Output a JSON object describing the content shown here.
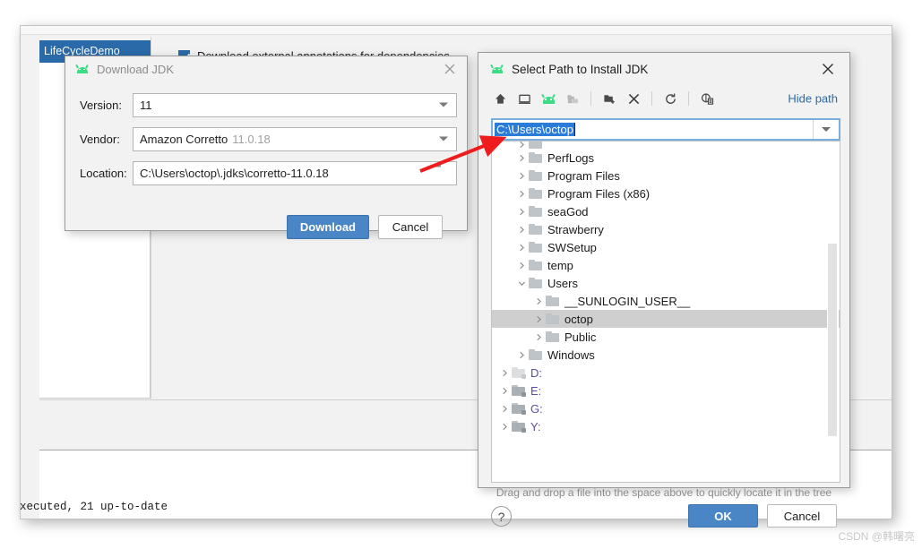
{
  "ide": {
    "project_tab": "LifeCycleDemo",
    "annotations_checkbox_label": "Download external annotations for dependencies",
    "console_text": "xecuted, 21 up-to-date"
  },
  "download_dialog": {
    "title": "Download JDK",
    "icon": "android-robot-icon",
    "close_glyph": "×",
    "fields": [
      {
        "label": "Version:",
        "value": "11",
        "suffix": ""
      },
      {
        "label": "Vendor:",
        "value": "Amazon Corretto",
        "suffix": "11.0.18"
      },
      {
        "label": "Location:",
        "value": "C:\\Users\\octop\\.jdks\\corretto-11.0.18",
        "suffix": ""
      }
    ],
    "download_button": "Download",
    "cancel_button": "Cancel",
    "primary_color": "#4a86c5"
  },
  "select_dialog": {
    "title": "Select Path to Install JDK",
    "icon": "android-robot-icon",
    "close_glyph": "×",
    "toolbar": [
      {
        "name": "home-icon",
        "tip": "Home"
      },
      {
        "name": "desktop-icon",
        "tip": "Desktop"
      },
      {
        "name": "android-robot-icon",
        "tip": "Project"
      },
      {
        "name": "folder-stack-icon",
        "tip": "Modules"
      },
      {
        "name": "new-folder-icon",
        "tip": "New Folder"
      },
      {
        "name": "delete-icon",
        "tip": "Delete"
      },
      {
        "name": "refresh-icon",
        "tip": "Refresh"
      },
      {
        "name": "show-hidden-icon",
        "tip": "Show Hidden Files"
      }
    ],
    "hide_path_label": "Hide path",
    "path_value": "C:\\Users\\octop",
    "tree": [
      {
        "label": "",
        "depth": 1,
        "state": "collapsed",
        "kind": "folder",
        "clipped": true
      },
      {
        "label": "PerfLogs",
        "depth": 1,
        "state": "collapsed",
        "kind": "folder"
      },
      {
        "label": "Program Files",
        "depth": 1,
        "state": "collapsed",
        "kind": "folder"
      },
      {
        "label": "Program Files (x86)",
        "depth": 1,
        "state": "collapsed",
        "kind": "folder"
      },
      {
        "label": "seaGod",
        "depth": 1,
        "state": "collapsed",
        "kind": "folder"
      },
      {
        "label": "Strawberry",
        "depth": 1,
        "state": "collapsed",
        "kind": "folder"
      },
      {
        "label": "SWSetup",
        "depth": 1,
        "state": "collapsed",
        "kind": "folder"
      },
      {
        "label": "temp",
        "depth": 1,
        "state": "collapsed",
        "kind": "folder"
      },
      {
        "label": "Users",
        "depth": 1,
        "state": "expanded",
        "kind": "folder"
      },
      {
        "label": "__SUNLOGIN_USER__",
        "depth": 2,
        "state": "collapsed",
        "kind": "folder"
      },
      {
        "label": "octop",
        "depth": 2,
        "state": "collapsed",
        "kind": "folder",
        "selected": true
      },
      {
        "label": "Public",
        "depth": 2,
        "state": "collapsed",
        "kind": "folder"
      },
      {
        "label": "Windows",
        "depth": 1,
        "state": "collapsed",
        "kind": "folder"
      },
      {
        "label": "D:",
        "depth": 0,
        "state": "collapsed",
        "kind": "drive-dim"
      },
      {
        "label": "E:",
        "depth": 0,
        "state": "collapsed",
        "kind": "drive"
      },
      {
        "label": "G:",
        "depth": 0,
        "state": "collapsed",
        "kind": "drive"
      },
      {
        "label": "Y:",
        "depth": 0,
        "state": "collapsed",
        "kind": "drive"
      }
    ],
    "hint": "Drag and drop a file into the space above to quickly locate it in the tree",
    "help_label": "?",
    "ok_button": "OK",
    "cancel_button": "Cancel",
    "primary_color": "#4a86c5",
    "link_color": "#2a6aa8",
    "selection_color": "#2a7cd8"
  },
  "annotation": {
    "arrow_color": "#ee1c1c"
  },
  "watermark": "CSDN @韩曙亮"
}
